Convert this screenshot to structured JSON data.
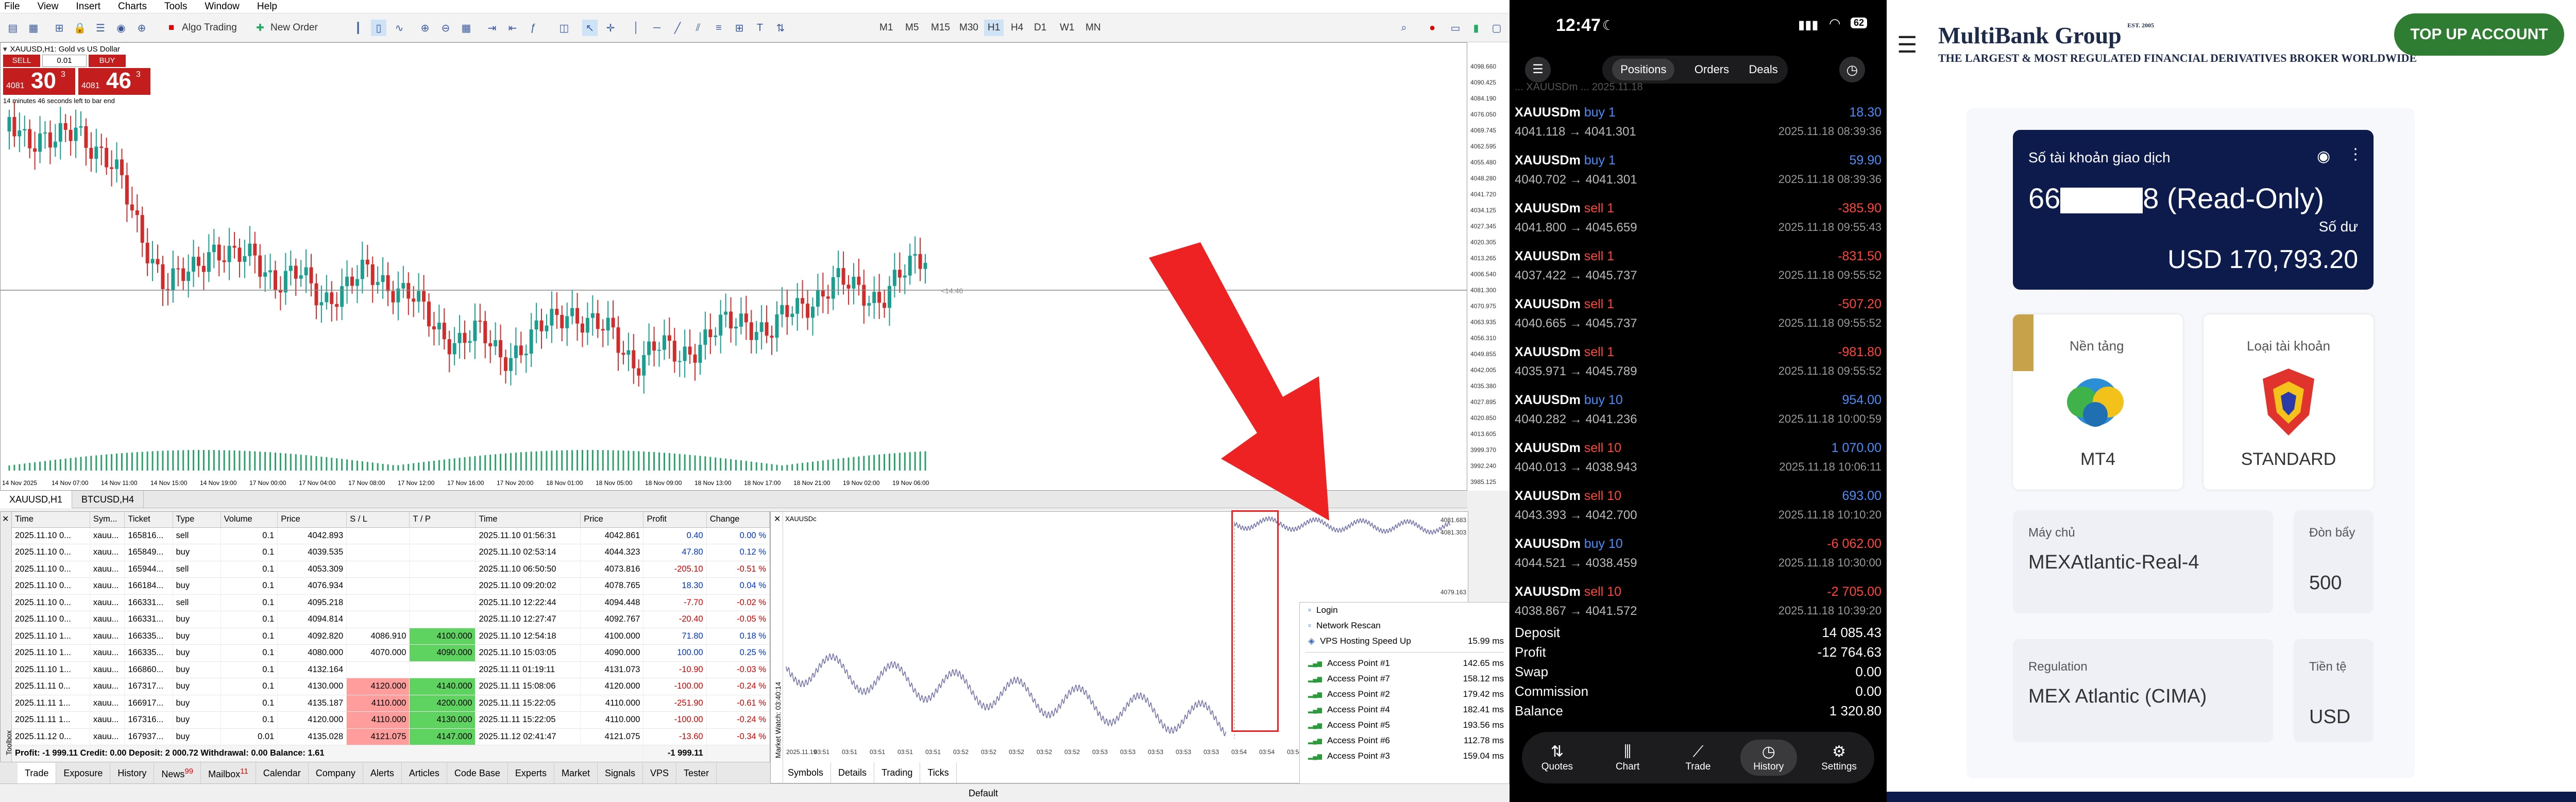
{
  "mt4": {
    "menu": [
      "File",
      "View",
      "Insert",
      "Charts",
      "Tools",
      "Window",
      "Help"
    ],
    "toolbar": {
      "algo_trading": "Algo Trading",
      "new_order": "New Order",
      "timeframes": [
        "M1",
        "M5",
        "M15",
        "M30",
        "H1",
        "H4",
        "D1",
        "W1",
        "MN"
      ]
    },
    "chart": {
      "title": "XAUUSD,H1: Gold vs US Dollar",
      "sell_label": "SELL",
      "buy_label": "BUY",
      "lot": "0.01",
      "sell_price_small": "4081",
      "sell_price_big": "30",
      "sell_price_sup": "3",
      "buy_price_small": "4081",
      "buy_price_big": "46",
      "buy_price_sup": "3",
      "countdown": "14 minutes 46 seconds left to bar end",
      "timer_label": "<14:46",
      "axis_prices": [
        "4098.660",
        "4090.425",
        "4084.190",
        "4076.050",
        "4069.745",
        "4062.595",
        "4055.480",
        "4048.280",
        "4041.720",
        "4034.125",
        "4027.345",
        "4020.305",
        "4013.265",
        "4006.540",
        "4081.300",
        "4070.975",
        "4063.935",
        "4056.310",
        "4049.855",
        "4042.005",
        "4035.380",
        "4027.895",
        "4020.850",
        "4013.605",
        "3999.370",
        "3992.240",
        "3985.125"
      ],
      "axis_times": [
        "14 Nov 2025",
        "14 Nov 07:00",
        "14 Nov 11:00",
        "14 Nov 15:00",
        "14 Nov 19:00",
        "17 Nov 00:00",
        "17 Nov 04:00",
        "17 Nov 08:00",
        "17 Nov 12:00",
        "17 Nov 16:00",
        "17 Nov 20:00",
        "18 Nov 01:00",
        "18 Nov 05:00",
        "18 Nov 09:00",
        "18 Nov 13:00",
        "18 Nov 17:00",
        "18 Nov 21:00",
        "19 Nov 02:00",
        "19 Nov 06:00"
      ],
      "tabs": [
        "XAUUSD,H1",
        "BTCUSD,H4"
      ]
    },
    "terminal": {
      "headers": [
        "Time",
        "Sym...",
        "Ticket",
        "Type",
        "Volume",
        "Price",
        "S / L",
        "T / P",
        "Time",
        "Price",
        "Profit",
        "Change"
      ],
      "rows": [
        [
          "2025.11.10 0...",
          "xauu...",
          "165816...",
          "sell",
          "0.1",
          "4042.893",
          "",
          "",
          "2025.11.10 01:56:31",
          "4042.861",
          "0.40",
          "0.00 %"
        ],
        [
          "2025.11.10 0...",
          "xauu...",
          "165849...",
          "buy",
          "0.1",
          "4039.535",
          "",
          "",
          "2025.11.10 02:53:14",
          "4044.323",
          "47.80",
          "0.12 %"
        ],
        [
          "2025.11.10 0...",
          "xauu...",
          "165944...",
          "sell",
          "0.1",
          "4053.309",
          "",
          "",
          "2025.11.10 06:50:50",
          "4073.816",
          "-205.10",
          "-0.51 %"
        ],
        [
          "2025.11.10 0...",
          "xauu...",
          "166184...",
          "buy",
          "0.1",
          "4076.934",
          "",
          "",
          "2025.11.10 09:20:02",
          "4078.765",
          "18.30",
          "0.04 %"
        ],
        [
          "2025.11.10 0...",
          "xauu...",
          "166331...",
          "sell",
          "0.1",
          "4095.218",
          "",
          "",
          "2025.11.10 12:22:44",
          "4094.448",
          "-7.70",
          "-0.02 %"
        ],
        [
          "2025.11.10 0...",
          "xauu...",
          "166331...",
          "buy",
          "0.1",
          "4094.814",
          "",
          "",
          "2025.11.10 12:27:47",
          "4092.767",
          "-20.40",
          "-0.05 %"
        ],
        [
          "2025.11.10 1...",
          "xauu...",
          "166335...",
          "buy",
          "0.1",
          "4092.820",
          "4086.910",
          "4100.000",
          "2025.11.10 12:54:18",
          "4100.000",
          "71.80",
          "0.18 %"
        ],
        [
          "2025.11.10 1...",
          "xauu...",
          "166335...",
          "buy",
          "0.1",
          "4080.000",
          "4070.000",
          "4090.000",
          "2025.11.10 15:03:05",
          "4090.000",
          "100.00",
          "0.25 %"
        ],
        [
          "2025.11.10 1...",
          "xauu...",
          "166860...",
          "buy",
          "0.1",
          "4132.164",
          "",
          "",
          "2025.11.11 01:19:11",
          "4131.073",
          "-10.90",
          "-0.03 %"
        ],
        [
          "2025.11.11 0...",
          "xauu...",
          "167317...",
          "buy",
          "0.1",
          "4130.000",
          "4120.000",
          "4140.000",
          "2025.11.11 15:08:06",
          "4120.000",
          "-100.00",
          "-0.24 %"
        ],
        [
          "2025.11.11 1...",
          "xauu...",
          "166917...",
          "buy",
          "0.1",
          "4135.187",
          "4110.000",
          "4200.000",
          "2025.11.11 15:22:05",
          "4110.000",
          "-251.90",
          "-0.61 %"
        ],
        [
          "2025.11.11 1...",
          "xauu...",
          "167316...",
          "buy",
          "0.1",
          "4120.000",
          "4110.000",
          "4130.000",
          "2025.11.11 15:22:05",
          "4110.000",
          "-100.00",
          "-0.24 %"
        ],
        [
          "2025.11.12 0...",
          "xauu...",
          "167937...",
          "buy",
          "0.01",
          "4135.028",
          "4121.075",
          "4147.000",
          "2025.11.12 02:41:47",
          "4121.075",
          "-13.60",
          "-0.34 %"
        ]
      ],
      "summary": "Profit: -1 999.11  Credit: 0.00  Deposit: 2 000.72  Withdrawal: 0.00  Balance: 1.61",
      "summary_total": "-1 999.11",
      "tabs": [
        "Trade",
        "Exposure",
        "History",
        "News",
        "Mailbox",
        "Calendar",
        "Company",
        "Alerts",
        "Articles",
        "Code Base",
        "Experts",
        "Market",
        "Signals",
        "VPS",
        "Tester"
      ],
      "news_badge": "99",
      "mailbox_badge": "11",
      "side_label": "Toolbox"
    },
    "watch": {
      "title": "XAUUSDc",
      "side_label": "Market Watch: 03:40:14",
      "tabs": [
        "Symbols",
        "Details",
        "Trading",
        "Ticks"
      ],
      "price_top": "4081.683",
      "price_mid": "4081.303",
      "price_bot": "4079.163",
      "x_labels": [
        "2025.11.19",
        "03:51",
        "03:51",
        "03:51",
        "03:51",
        "03:51",
        "03:52",
        "03:52",
        "03:52",
        "03:52",
        "03:52",
        "03:53",
        "03:53",
        "03:53",
        "03:53",
        "03:53",
        "03:54",
        "03:54",
        "03:54",
        "03:54"
      ]
    },
    "nav_panel": {
      "items": [
        "Login",
        "Network Rescan",
        "VPS Hosting Speed Up"
      ],
      "vps_speed": "15.99 ms",
      "access_points": [
        {
          "name": "Access Point #1",
          "ms": "142.65 ms"
        },
        {
          "name": "Access Point #7",
          "ms": "158.12 ms"
        },
        {
          "name": "Access Point #2",
          "ms": "179.42 ms"
        },
        {
          "name": "Access Point #4",
          "ms": "182.41 ms"
        },
        {
          "name": "Access Point #5",
          "ms": "193.56 ms"
        },
        {
          "name": "Access Point #6",
          "ms": "112.78 ms"
        },
        {
          "name": "Access Point #3",
          "ms": "159.04 ms"
        }
      ]
    },
    "status_default": "Default"
  },
  "phone": {
    "time": "12:47",
    "battery": "62",
    "tabs": [
      "Positions",
      "Orders",
      "Deals"
    ],
    "account_line": "... XAUUSDm ... 2025.11.18",
    "rows": [
      {
        "sym": "XAUUSDm",
        "side": "buy 1",
        "prices": "4041.118 → 4041.301",
        "profit": "18.30",
        "date": "2025.11.18 08:39:36",
        "dir": "buy"
      },
      {
        "sym": "XAUUSDm",
        "side": "buy 1",
        "prices": "4040.702 → 4041.301",
        "profit": "59.90",
        "date": "2025.11.18 08:39:36",
        "dir": "buy"
      },
      {
        "sym": "XAUUSDm",
        "side": "sell 1",
        "prices": "4041.800 → 4045.659",
        "profit": "-385.90",
        "date": "2025.11.18 09:55:43",
        "dir": "sell"
      },
      {
        "sym": "XAUUSDm",
        "side": "sell 1",
        "prices": "4037.422 → 4045.737",
        "profit": "-831.50",
        "date": "2025.11.18 09:55:52",
        "dir": "sell"
      },
      {
        "sym": "XAUUSDm",
        "side": "sell 1",
        "prices": "4040.665 → 4045.737",
        "profit": "-507.20",
        "date": "2025.11.18 09:55:52",
        "dir": "sell"
      },
      {
        "sym": "XAUUSDm",
        "side": "sell 1",
        "prices": "4035.971 → 4045.789",
        "profit": "-981.80",
        "date": "2025.11.18 09:55:52",
        "dir": "sell"
      },
      {
        "sym": "XAUUSDm",
        "side": "buy 10",
        "prices": "4040.282 → 4041.236",
        "profit": "954.00",
        "date": "2025.11.18 10:00:59",
        "dir": "buy"
      },
      {
        "sym": "XAUUSDm",
        "side": "sell 10",
        "prices": "4040.013 → 4038.943",
        "profit": "1 070.00",
        "date": "2025.11.18 10:06:11",
        "dir": "sell",
        "pos": true
      },
      {
        "sym": "XAUUSDm",
        "side": "sell 10",
        "prices": "4043.393 → 4042.700",
        "profit": "693.00",
        "date": "2025.11.18 10:10:20",
        "dir": "sell",
        "pos": true
      },
      {
        "sym": "XAUUSDm",
        "side": "buy 10",
        "prices": "4044.521 → 4038.459",
        "profit": "-6 062.00",
        "date": "2025.11.18 10:30:00",
        "dir": "buy"
      },
      {
        "sym": "XAUUSDm",
        "side": "sell 10",
        "prices": "4038.867 → 4041.572",
        "profit": "-2 705.00",
        "date": "2025.11.18 10:39:20",
        "dir": "sell"
      }
    ],
    "summary": [
      {
        "label": "Deposit",
        "value": "14 085.43"
      },
      {
        "label": "Profit",
        "value": "-12 764.63"
      },
      {
        "label": "Swap",
        "value": "0.00"
      },
      {
        "label": "Commission",
        "value": "0.00"
      },
      {
        "label": "Balance",
        "value": "1 320.80"
      }
    ],
    "nav": [
      "Quotes",
      "Chart",
      "Trade",
      "History",
      "Settings"
    ]
  },
  "broker": {
    "brand": "MultiBank Group",
    "est": "EST. 2005",
    "tagline": "THE LARGEST & MOST REGULATED FINANCIAL DERIVATIVES BROKER WORLDWIDE",
    "topup": "TOP UP ACCOUNT",
    "acct_label": "Số tài khoản giao dịch",
    "acct_prefix": "66",
    "acct_suffix": "8 (Read-Only)",
    "balance_label": "Số dư",
    "balance": "USD 170,793.20",
    "platform_label": "Nền tảng",
    "platform": "MT4",
    "type_label": "Loại tài khoản",
    "type": "STANDARD",
    "server_label": "Máy chủ",
    "server": "MEXAtlantic-Real-4",
    "leverage_label": "Đòn bẩy",
    "leverage": "500",
    "reg_label": "Regulation",
    "reg": "MEX Atlantic (CIMA)",
    "currency_label": "Tiền tệ",
    "currency": "USD"
  },
  "colors": {
    "bull": "#1a9e8f",
    "bear": "#d22b2b",
    "arrow": "#ee2222",
    "green": "#2e7d32",
    "navy": "#0d1b4c"
  }
}
